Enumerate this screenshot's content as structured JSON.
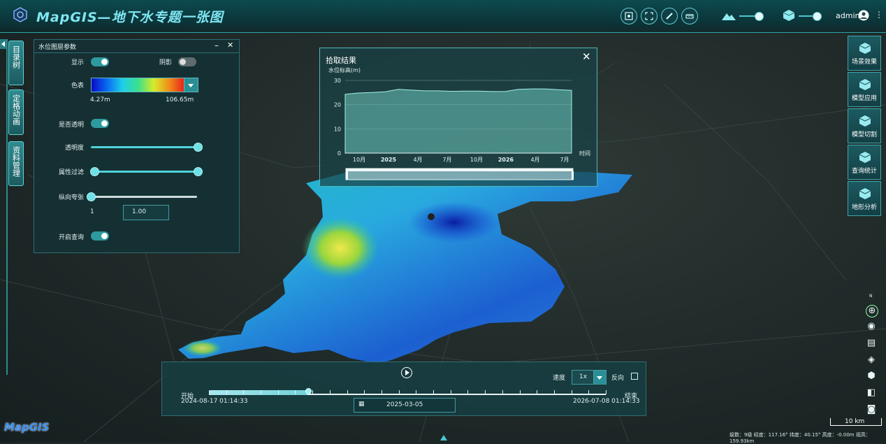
{
  "app": {
    "title": "MapGIS—地下水专题一张图",
    "user": "admin",
    "logo_text": "MapGIS"
  },
  "toolbar": {
    "icons": [
      "screenshot-icon",
      "frame-icon",
      "measure-icon",
      "ruler-icon"
    ]
  },
  "left_tabs": [
    "目录树",
    "定格动画",
    "资料管理"
  ],
  "layer_panel": {
    "title": "水位图层参数",
    "show_label": "显示",
    "shadow_label": "阴影",
    "colorbar_label": "色表",
    "color_min": "4.27m",
    "color_max": "106.65m",
    "transparent_label": "是否透明",
    "opacity_label": "透明度",
    "filter_label": "属性过滤",
    "exaggeration_label": "纵向夸张",
    "exaggeration_min": "1",
    "exaggeration_value": "1.00",
    "query_label": "开启查询",
    "show_on": true,
    "shadow_on": false,
    "transparent_on": true,
    "query_on": true
  },
  "pick_result": {
    "title": "拾取结果",
    "chart_data": {
      "type": "area",
      "ylabel": "水位标高(m)",
      "xlabel": "时间",
      "ylim": [
        0,
        30
      ],
      "yticks": [
        "30",
        "20",
        "10",
        "0"
      ],
      "xticks": [
        "10月",
        "2025",
        "4月",
        "7月",
        "10月",
        "2026",
        "4月",
        "7月"
      ],
      "values": [
        24.3,
        24.8,
        25.0,
        25.3,
        26.3,
        26.0,
        25.7,
        25.7,
        25.5,
        25.6,
        25.6,
        25.4,
        25.4,
        26.3,
        26.5,
        26.5,
        26.2,
        25.9
      ]
    }
  },
  "right_panel": [
    "场景效果",
    "模型应用",
    "模型切割",
    "查询统计",
    "地形分析"
  ],
  "timeline": {
    "start_label": "开始",
    "end_label": "结束",
    "start_time": "2024-08-17 01:14:33",
    "end_time": "2026-07-08 01:14:33",
    "current_date": "2025-03-05",
    "speed_label": "速度",
    "speed_value": "1x",
    "reverse_label": "反向",
    "progress": 0.25
  },
  "scale": {
    "label": "10 km"
  },
  "status_bar": "级数：9级 经度：117.16° 纬度：40.15° 高度：-0.00m 视高：159.93km",
  "colors": {
    "accent": "#4ed3da",
    "panel": "#143034",
    "title": "#7fe6f2"
  }
}
